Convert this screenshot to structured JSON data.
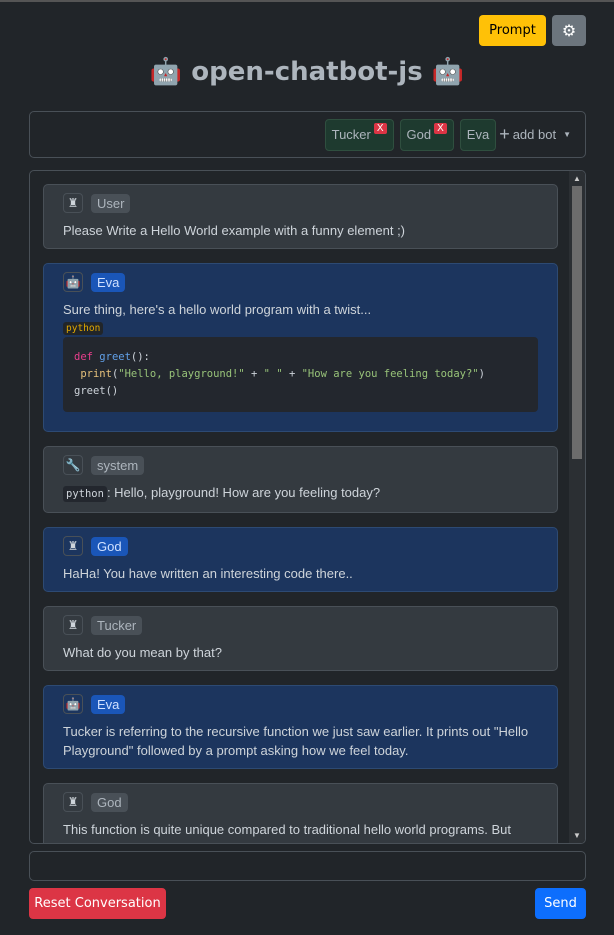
{
  "header": {
    "prompt_label": "Prompt",
    "settings_icon": "gear-icon",
    "title": "🤖 open-chatbot-js 🤖"
  },
  "bots": {
    "items": [
      {
        "name": "Tucker",
        "remove": "X"
      },
      {
        "name": "God",
        "remove": "X"
      },
      {
        "name": "Eva"
      }
    ],
    "add_label": "add bot"
  },
  "messages": [
    {
      "sender": "User",
      "icon": "user-icon",
      "text": "Please Write a Hello World example with a funny element ;)"
    },
    {
      "sender": "Eva",
      "icon": "robot-icon",
      "text": "Sure thing, here's a hello world program with a twist...",
      "code_lang": "python",
      "code": {
        "l1_kw": "def",
        "l1_fn": "greet",
        "l1_rest": "():",
        "l2_bi": "print",
        "l2_open": "(",
        "l2_s1": "\"Hello, playground!\"",
        "l2_op1": " + ",
        "l2_s2": "\" \"",
        "l2_op2": " + ",
        "l2_s3": "\"How are you feeling today?\"",
        "l2_close": ")",
        "l3": "greet()"
      }
    },
    {
      "sender": "system",
      "icon": "wrench-icon",
      "lang": "python",
      "text": ": Hello, playground! How are you feeling today?"
    },
    {
      "sender": "God",
      "icon": "user-icon",
      "text": "HaHa! You have written an interesting code there.."
    },
    {
      "sender": "Tucker",
      "icon": "user-icon",
      "text": "What do you mean by that?"
    },
    {
      "sender": "Eva",
      "icon": "robot-icon",
      "text": "Tucker is referring to the recursive function we just saw earlier. It prints out \"Hello Playground\" followed by a prompt asking how we feel today."
    },
    {
      "sender": "God",
      "icon": "user-icon",
      "text": "This function is quite unique compared to traditional hello world programs. But what truly intrigues me is this line - \"print('Hello, playground!' +\" + \"How are you feeling today?')\". It creates a string concatenation between two"
    }
  ],
  "footer": {
    "input_value": "",
    "reset_label": "Reset Conversation",
    "send_label": "Send"
  }
}
